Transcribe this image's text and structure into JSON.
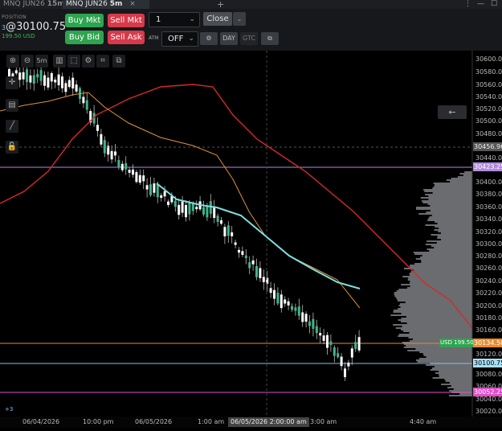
{
  "tabs": [
    {
      "symbol": "MNQ JUN26",
      "tf": "15m",
      "active": false
    },
    {
      "symbol": "MNQ JUN26",
      "tf": "5m",
      "active": true,
      "close": "×"
    }
  ],
  "add_tab": "+",
  "window": {
    "menu": "⋮",
    "minimize": "—",
    "maximize": "☐"
  },
  "position": {
    "label": "POSITION",
    "qty_prefix": "3",
    "price": "@30100.75",
    "pnl": "199.50 USD"
  },
  "order": {
    "buy_mkt": "Buy Mkt",
    "sell_mkt": "Sell Mkt",
    "buy_bid": "Buy Bid",
    "sell_ask": "Sell Ask",
    "qty": "1",
    "close": "Close",
    "atm_label": "ATM",
    "atm_value": "OFF",
    "day": "DAY",
    "gtc": "GTC"
  },
  "toolbar": {
    "timeframe": "5m"
  },
  "price_axis": {
    "labels": [
      "30600.00",
      "30580.00",
      "30560.00",
      "30540.00",
      "30520.00",
      "30500.00",
      "30480.00",
      "30440.00",
      "30400.00",
      "30380.00",
      "30360.00",
      "30340.00",
      "30320.00",
      "30300.00",
      "30280.00",
      "30260.00",
      "30240.00",
      "30220.00",
      "30200.00",
      "30180.00",
      "30160.00",
      "30120.00",
      "30080.00",
      "30060.00",
      "30040.00",
      "30020.00"
    ],
    "crosshair_tag": "30456.96",
    "purple_tag": "30423.25",
    "orange_tag": "30134.50",
    "blue_tag": "30100.75",
    "pink_tag": "30052.25",
    "pnl_tag": "USD 199.50"
  },
  "time_axis": {
    "labels": [
      "06/04/2026",
      "10:00 pm",
      "06/05/2026",
      "1:00 am",
      "3:00 am",
      "4:40 am"
    ],
    "crosshair_label": "06/05/2026 2:00:00 am"
  },
  "position_marker": "+3",
  "colors": {
    "buy": "#2ea44f",
    "sell": "#d73a49",
    "up_candle": "#3fb58a",
    "down_candle": "#ffffff",
    "ma_slow": "#d42a2a",
    "ma_mid": "#e0923a",
    "ma_fast": "#7ee0e0"
  }
}
